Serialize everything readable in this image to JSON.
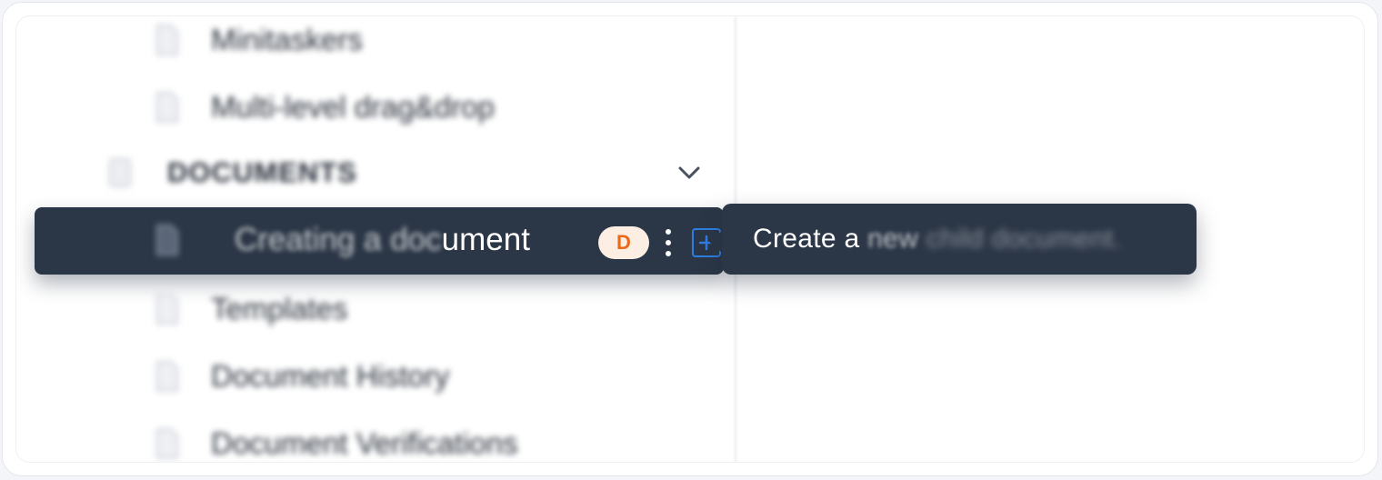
{
  "sidebar": {
    "items_above": [
      {
        "label": "Minitaskers",
        "icon": "document-icon"
      },
      {
        "label": "Multi-level drag&drop",
        "icon": "document-icon"
      }
    ],
    "section": {
      "title": "DOCUMENTS",
      "icon": "folder-icon",
      "toggle_icon": "chevron-down-icon"
    },
    "active_item": {
      "label_start": "Creating a doc",
      "label_end": "ument",
      "icon": "document-icon",
      "avatar_initial": "D",
      "more_icon": "kebab-menu-icon",
      "add_icon": "plus-square-icon"
    },
    "items_below": [
      {
        "label": "Templates",
        "icon": "document-icon"
      },
      {
        "label": "Document History",
        "icon": "document-icon"
      },
      {
        "label": "Document Verifications",
        "icon": "document-icon"
      }
    ]
  },
  "tooltip": {
    "part1": "Create a ",
    "part2": "new ",
    "part3": "child document."
  },
  "colors": {
    "active_bg": "#2b3646",
    "accent_blue": "#2f7de1",
    "avatar_bg": "#fdeee3",
    "avatar_text": "#ea6a1a"
  }
}
